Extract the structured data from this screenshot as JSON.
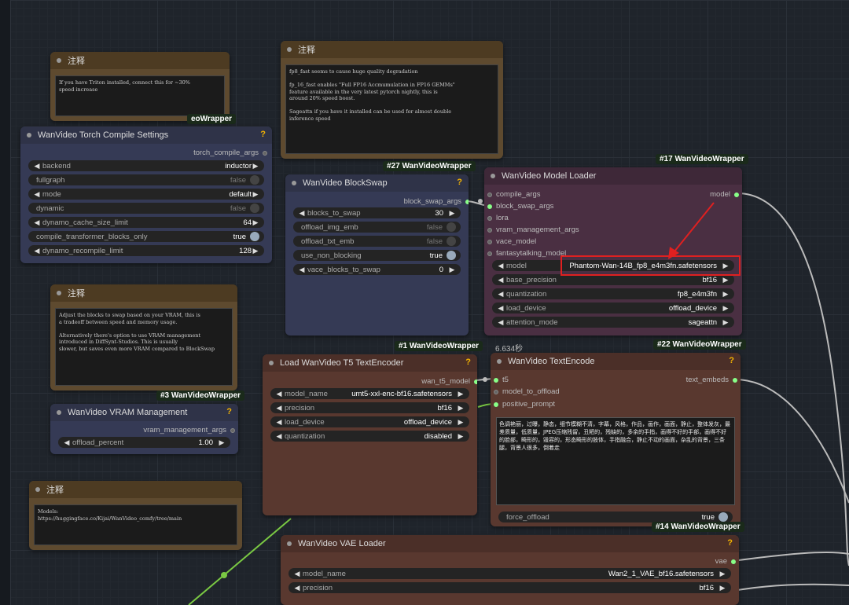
{
  "notes": [
    {
      "title": "注释",
      "text": "If you have Triton installed, connect this for ~30%\nspeed increase"
    },
    {
      "title": "注释",
      "text": "fp8_fast seems to cause huge quality degradation\n\nfp_16_fast enables \"Full FP16 Accmumulation in FP16 GEMMs\"\nfeature available in the very latest pytorch nightly, this is\naround 20% speed boost.\n\nSageattn if you have it installed can be used for almost double\ninference speed"
    },
    {
      "title": "注释",
      "text": "Adjust the blocks to swap based on your VRAM, this is\na tradeoff between speed and memory usage.\n\nAlternatively there's option to use VRAM management\nintroduced in DiffSynt-Studios. This is usually\nslower, but saves even more VRAM compared to BlockSwap"
    },
    {
      "title": "注释",
      "text": "Models:\nhttps://huggingface.co/Kijai/WanVideo_comfy/tree/main"
    }
  ],
  "badges": {
    "torch_wrapper": "eoWrapper",
    "blockswap": "#27 WanVideoWrapper",
    "model_loader": "#17 WanVideoWrapper",
    "t5": "#1 WanVideoWrapper",
    "vram": "#3 WanVideoWrapper",
    "textencode": "#22 WanVideoWrapper",
    "vae": "#14 WanVideoWrapper"
  },
  "torch_compile": {
    "title": "WanVideo Torch Compile Settings",
    "output": "torch_compile_args",
    "rows": [
      {
        "label": "backend",
        "value": "inductor"
      },
      {
        "label": "fullgraph",
        "value": "false"
      },
      {
        "label": "mode",
        "value": "default"
      },
      {
        "label": "dynamic",
        "value": "false"
      },
      {
        "label": "dynamo_cache_size_limit",
        "value": "64"
      },
      {
        "label": "compile_transformer_blocks_only",
        "value": "true"
      },
      {
        "label": "dynamo_recompile_limit",
        "value": "128"
      }
    ]
  },
  "blockswap": {
    "title": "WanVideo BlockSwap",
    "output": "block_swap_args",
    "rows": [
      {
        "label": "blocks_to_swap",
        "value": "30"
      },
      {
        "label": "offload_img_emb",
        "value": "false"
      },
      {
        "label": "offload_txt_emb",
        "value": "false"
      },
      {
        "label": "use_non_blocking",
        "value": "true"
      },
      {
        "label": "vace_blocks_to_swap",
        "value": "0"
      }
    ]
  },
  "model_loader": {
    "title": "WanVideo Model Loader",
    "output": "model",
    "inputs": [
      "compile_args",
      "block_swap_args",
      "lora",
      "vram_management_args",
      "vace_model",
      "fantasytalking_model"
    ],
    "rows": [
      {
        "label": "model",
        "value": "Phantom-Wan-14B_fp8_e4m3fn.safetensors"
      },
      {
        "label": "base_precision",
        "value": "bf16"
      },
      {
        "label": "quantization",
        "value": "fp8_e4m3fn"
      },
      {
        "label": "load_device",
        "value": "offload_device"
      },
      {
        "label": "attention_mode",
        "value": "sageattn"
      }
    ]
  },
  "t5": {
    "title": "Load WanVideo T5 TextEncoder",
    "output": "wan_t5_model",
    "rows": [
      {
        "label": "model_name",
        "value": "umt5-xxl-enc-bf16.safetensors"
      },
      {
        "label": "precision",
        "value": "bf16"
      },
      {
        "label": "load_device",
        "value": "offload_device"
      },
      {
        "label": "quantization",
        "value": "disabled"
      }
    ]
  },
  "vram": {
    "title": "WanVideo VRAM Management",
    "output": "vram_management_args",
    "rows": [
      {
        "label": "offload_percent",
        "value": "1.00"
      }
    ]
  },
  "textencode": {
    "timing": "6.634秒",
    "title": "WanVideo TextEncode",
    "output": "text_embeds",
    "inputs": [
      "t5",
      "model_to_offload",
      "positive_prompt"
    ],
    "prompt": "色调艳丽，过曝，静态，细节模糊不清，字幕，风格，作品，画作，画面，静止，整体发灰，最差质量，低质量，JPEG压缩残留，丑陋的，残缺的，多余的手指，画得不好的手部，画得不好的脸部，畸形的，毁容的，形态畸形的肢体，手指融合，静止不动的画面，杂乱的背景，三条腿，背景人很多，倒着走",
    "force_offload": {
      "label": "force_offload",
      "value": "true"
    }
  },
  "vae": {
    "title": "WanVideo VAE Loader",
    "output": "vae",
    "rows": [
      {
        "label": "model_name",
        "value": "Wan2_1_VAE_bf16.safetensors"
      },
      {
        "label": "precision",
        "value": "bf16"
      }
    ]
  }
}
